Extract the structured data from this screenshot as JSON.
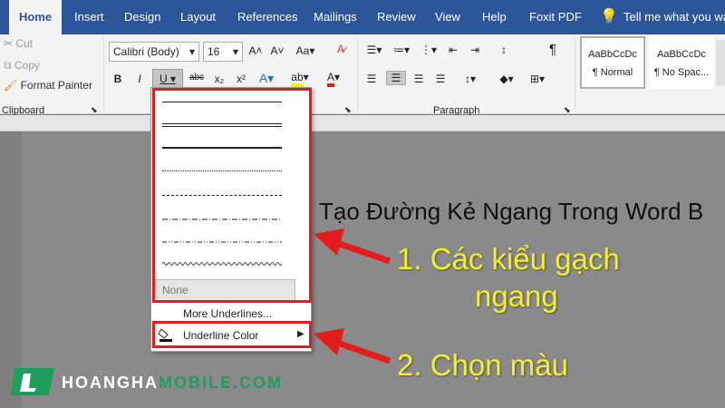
{
  "ribbon_tabs": [
    "Home",
    "Insert",
    "Design",
    "Layout",
    "References",
    "Mailings",
    "Review",
    "View",
    "Help",
    "Foxit PDF"
  ],
  "tell_me": "Tell me what you want",
  "clipboard": {
    "cut": "Cut",
    "copy": "Copy",
    "format_painter": "Format Painter",
    "group": "Clipboard"
  },
  "font": {
    "name": "Calibri (Body)",
    "size": "16",
    "bold": "B",
    "italic": "I",
    "underline": "U",
    "strike": "abc",
    "sub": "x₂",
    "sup": "x²"
  },
  "paragraph": {
    "group": "Paragraph",
    "pilcrow": "¶"
  },
  "styles": [
    {
      "preview": "AaBbCcDc",
      "name": "¶ Normal"
    },
    {
      "preview": "AaBbCcDc",
      "name": "¶ No Spac..."
    }
  ],
  "document_text": "Tạo Đường Kẻ Ngang Trong Word B",
  "underline_menu": {
    "none": "None",
    "more": "More Underlines...",
    "color": "Underline Color",
    "styles": [
      "single",
      "double",
      "thick",
      "dotted",
      "dashed",
      "dash-dot",
      "dash-dot-dot",
      "wave"
    ]
  },
  "annotations": {
    "line1a": "1. Các kiểu gạch",
    "line1b": "ngang",
    "line2": "2. Chọn màu"
  },
  "logo": {
    "part1": "HOANGHA",
    "part2": "MOBILE.COM"
  },
  "colors": {
    "ribbon_blue": "#2b579a",
    "highlight_red": "#e21d1d",
    "annotation_yellow": "#f5ef2a",
    "logo_green": "#1e9e5a"
  }
}
